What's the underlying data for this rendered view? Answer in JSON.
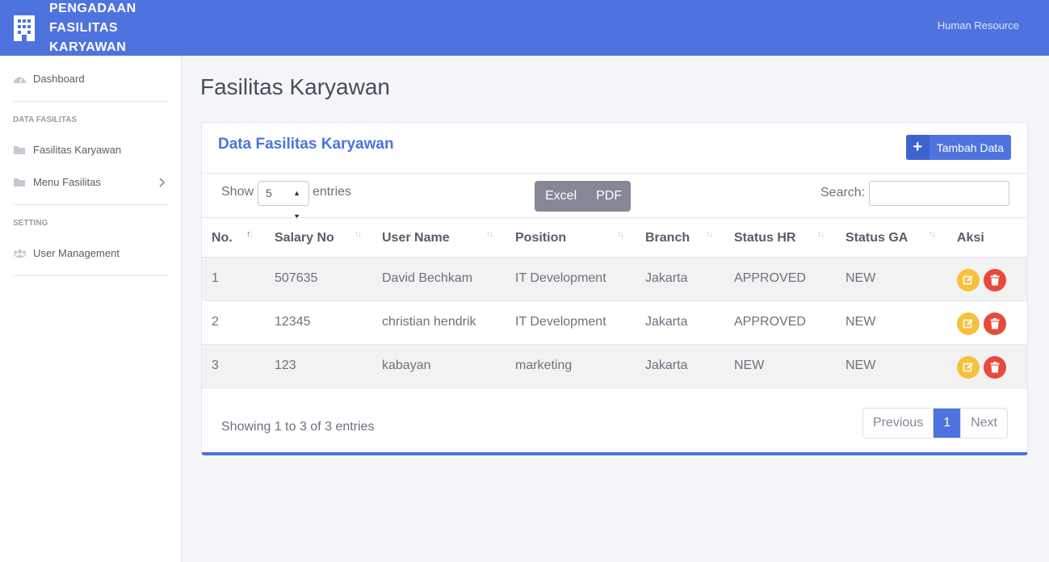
{
  "app": {
    "brand_line1": "PENGADAAN",
    "brand_line2": "FASILITAS",
    "brand_line3": "KARYAWAN",
    "user": "Human Resource"
  },
  "sidebar": {
    "dashboard": "Dashboard",
    "heading_data": "DATA FASILITAS",
    "fasilitas_karyawan": "Fasilitas Karyawan",
    "menu_fasilitas": "Menu Fasilitas",
    "heading_setting": "SETTING",
    "user_management": "User Management"
  },
  "page": {
    "title": "Fasilitas Karyawan"
  },
  "card": {
    "title": "Data Fasilitas Karyawan",
    "add_button": "Tambah Data",
    "show_label": "Show",
    "length_value": "5",
    "entries_label": "entries",
    "export_excel": "Excel",
    "export_pdf": "PDF",
    "search_label": "Search:",
    "search_value": ""
  },
  "table": {
    "headers": [
      "No.",
      "Salary No",
      "User Name",
      "Position",
      "Branch",
      "Status HR",
      "Status GA",
      "Aksi"
    ],
    "rows": [
      [
        "1",
        "507635",
        "David Bechkam",
        "IT Development",
        "Jakarta",
        "APPROVED",
        "NEW"
      ],
      [
        "2",
        "12345",
        "christian hendrik",
        "IT Development",
        "Jakarta",
        "APPROVED",
        "NEW"
      ],
      [
        "3",
        "123",
        "kabayan",
        "marketing",
        "Jakarta",
        "NEW",
        "NEW"
      ]
    ]
  },
  "footer": {
    "info": "Showing 1 to 3 of 3 entries",
    "prev": "Previous",
    "current_page": "1",
    "next": "Next"
  },
  "colors": {
    "primary": "#4e73df",
    "warning": "#f6c23e",
    "danger": "#e74a3b",
    "secondary": "#858796"
  }
}
